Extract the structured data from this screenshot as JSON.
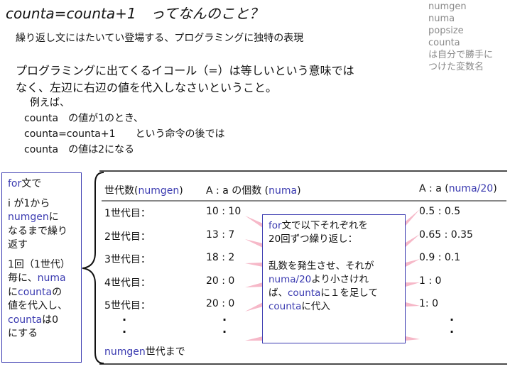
{
  "title": "counta=counta+1　ってなんのこと？",
  "subtitle": "繰り返し文にはたいてい登場する、プログラミングに独特の表現",
  "intro": {
    "line1": "プログラミングに出てくるイコール（=）は等しいという意味では",
    "line2": "なく、左辺に右辺の値を代入しなさいということ。"
  },
  "example": {
    "l1": "例えば、",
    "l2": "counta　の値が1のとき、",
    "l3": "counta=counta+1　　という命令の後では",
    "l4": "counta　の値は2になる"
  },
  "sidenote": {
    "lines": [
      "numgen",
      "numa",
      "popsize",
      "counta",
      "は自分で勝手に",
      "つけた変数名"
    ]
  },
  "leftbox": {
    "for_kw": "for",
    "for_rest": "文で",
    "l2": "i が1から",
    "l3_kw": "numgen",
    "l3_rest": "に",
    "l4": "なるまで繰り",
    "l5": "返す",
    "l6": "1回（1世代）",
    "l7_pre": "毎に、",
    "l7_kw": "numa",
    "l8_pre": "に",
    "l8_kw": "counta",
    "l8_post": "の",
    "l9": "値を代入し、",
    "l10_kw": "counta",
    "l10_post": "は0",
    "l11": "にする"
  },
  "table": {
    "h1_pre": "世代数(",
    "h1_kw": "numgen",
    "h1_post": ")",
    "h2_pre": "A : a の個数 (",
    "h2_kw": "numa",
    "h2_post": ")",
    "h3_pre": "A : a (",
    "h3_kw": "numa/20",
    "h3_post": ")",
    "rows": [
      {
        "gen": "1世代目：",
        "count": "10 : 10",
        "ratio": "0.5 : 0.5"
      },
      {
        "gen": "2世代目：",
        "count": "13 :  7",
        "ratio": "0.65 : 0.35"
      },
      {
        "gen": "3世代目：",
        "count": "18 :  2",
        "ratio": "0.9 : 0.1"
      },
      {
        "gen": "4世代目：",
        "count": "20 :  0",
        "ratio": "1  :  0"
      },
      {
        "gen": "5世代目：",
        "count": "20 :  0",
        "ratio": "1:   0"
      }
    ],
    "dot": ".",
    "footer_kw": "numgen",
    "footer_rest": "世代まで"
  },
  "callout": {
    "l1_kw": "for",
    "l1_rest": "文で以下それぞれを",
    "l2": "20回ずつ繰り返し：",
    "l3": "乱数を発生させ、それが",
    "l4_kw": "numa/20",
    "l4_rest": "より小さけれ",
    "l5_pre": "ば、",
    "l5_kw": "counta",
    "l5_rest": "に１を足して",
    "l6_kw": "counta",
    "l6_rest": "に代入"
  },
  "colors": {
    "accent_blue": "#3a3ab0",
    "arrow_pink": "#f6b8c8",
    "note_gray": "#8a8a8a"
  }
}
